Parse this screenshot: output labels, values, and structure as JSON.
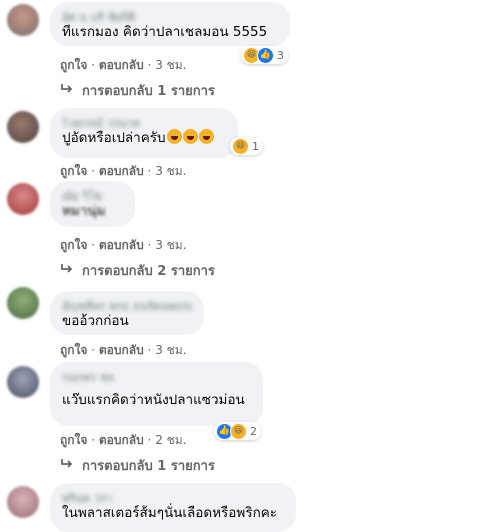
{
  "colors": {
    "bubble": "#f0f2f5",
    "meta": "#65676b",
    "like_blue": "#1877f2",
    "laugh_yellow": "#f7b125"
  },
  "comments": [
    {
      "author": "อัศ นุ บุรี ชัยกิติ",
      "text": "ทีแรกมอง คิดว่าปลาเชลมอน 5555",
      "like_label": "ถูกใจ",
      "reply_label": "ตอบกลับ",
      "time": "3 ชม.",
      "reactions": {
        "icons": [
          "laugh-icon",
          "like-icon"
        ],
        "count": "3"
      },
      "replies_label": "การตอบกลับ 1 รายการ"
    },
    {
      "author": "ไวยกรณ์ วรนาท",
      "text": "ปูอัดหรือเปล่าครับ",
      "text_emojis": [
        "laugh-emoji",
        "laugh-emoji",
        "laugh-emoji"
      ],
      "like_label": "ถูกใจ",
      "reply_label": "ตอบกลับ",
      "time": "3 ชม.",
      "reactions": {
        "icons": [
          "laugh-icon"
        ],
        "count": "1"
      }
    },
    {
      "author": "ณัฐ วิโซ",
      "text": "หมานุ่ม",
      "like_label": "ถูกใจ",
      "reply_label": "ตอบกลับ",
      "time": "3 ชม.",
      "replies_label": "การตอบกลับ 2 รายการ"
    },
    {
      "author": "อัญชลีพร พรธ ธนรัตนพฤกษ์",
      "text": "ขออ้วกก่อน",
      "like_label": "ถูกใจ",
      "reply_label": "ตอบกลับ",
      "time": "3 ชม."
    },
    {
      "author": "กนกพร ชล",
      "text": "แว๊บแรกคิดว่าหนังปลาแซวม่อน",
      "like_label": "ถูกใจ",
      "reply_label": "ตอบกลับ",
      "time": "2 ชม.",
      "reactions": {
        "icons": [
          "like-icon",
          "laugh-icon"
        ],
        "count": "2"
      },
      "replies_label": "การตอบกลับ 1 รายการ"
    },
    {
      "author": "พรินท วรา",
      "text": "ในพลาสเตอร์ส้มๆนั่นเลือดหรือพริกคะ"
    }
  ]
}
